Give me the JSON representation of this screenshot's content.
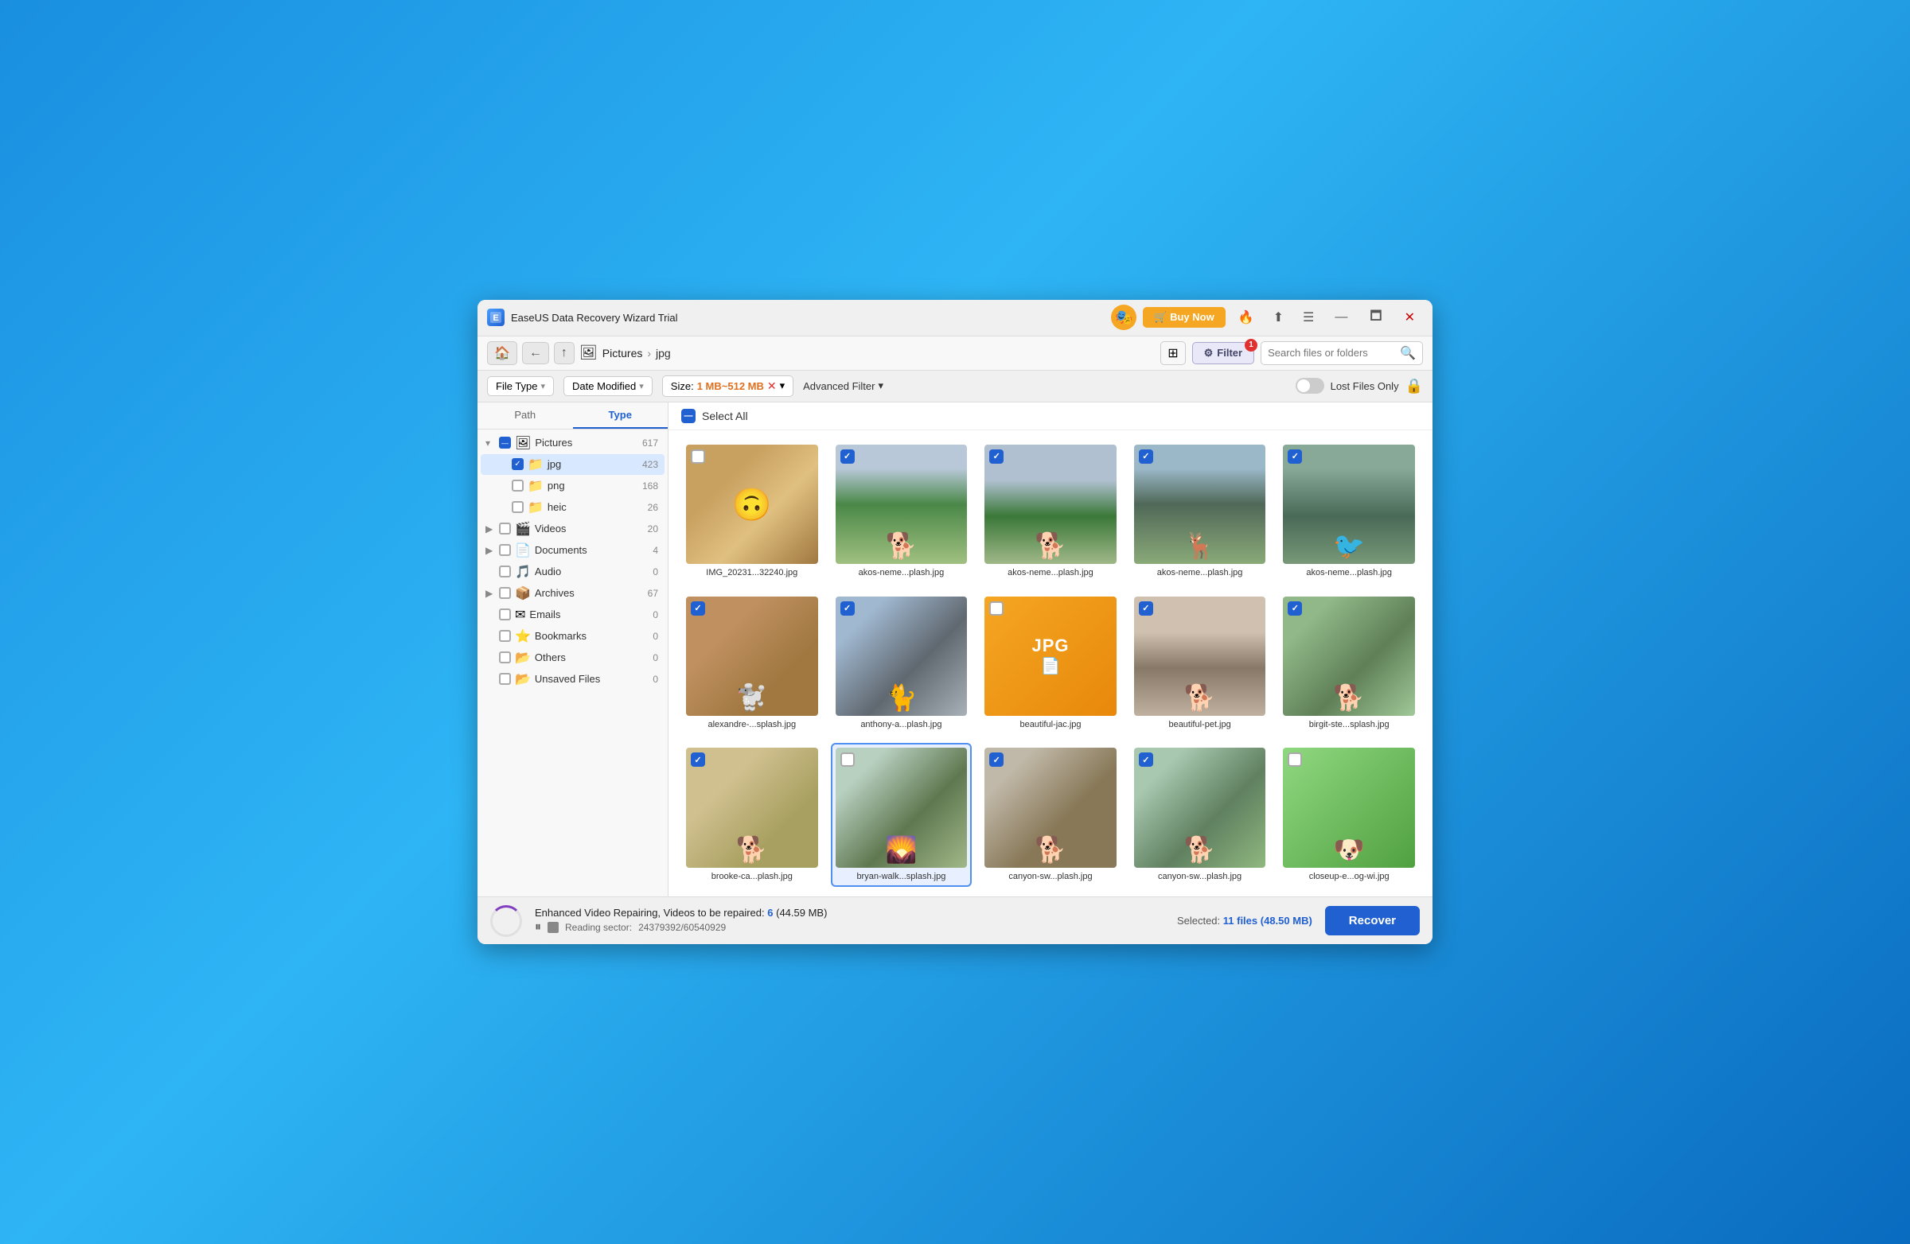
{
  "window": {
    "title": "EaseUS Data Recovery Wizard Trial",
    "logo_icon": "🔷",
    "buttons": {
      "buy_now": "🛒 Buy Now",
      "minimize": "—",
      "maximize": "🗖",
      "close": "✕"
    }
  },
  "nav": {
    "back_icon": "←",
    "up_icon": "↑",
    "home_icon": "🏠",
    "breadcrumb_icon": "🖼",
    "breadcrumb_folder": "Pictures",
    "breadcrumb_sep": "›",
    "breadcrumb_current": "jpg",
    "grid_icon": "⊞",
    "filter_label": "Filter",
    "filter_badge": "1",
    "search_placeholder": "Search files or folders"
  },
  "filters": {
    "file_type_label": "File Type",
    "date_modified_label": "Date Modified",
    "size_label": "Size:",
    "size_value": "1 MB~512 MB",
    "adv_filter_label": "Advanced Filter",
    "lost_files_label": "Lost Files Only"
  },
  "sidebar": {
    "tab_path": "Path",
    "tab_type": "Type",
    "items": [
      {
        "id": "pictures",
        "label": "Pictures",
        "count": "617",
        "level": 0,
        "checked": "partial",
        "expanded": true,
        "icon": "🖼"
      },
      {
        "id": "jpg",
        "label": "jpg",
        "count": "423",
        "level": 1,
        "checked": "checked",
        "expanded": false,
        "icon": "📁"
      },
      {
        "id": "png",
        "label": "png",
        "count": "168",
        "level": 1,
        "checked": "unchecked",
        "expanded": false,
        "icon": "📁"
      },
      {
        "id": "heic",
        "label": "heic",
        "count": "26",
        "level": 1,
        "checked": "unchecked",
        "expanded": false,
        "icon": "📁"
      },
      {
        "id": "videos",
        "label": "Videos",
        "count": "20",
        "level": 0,
        "checked": "unchecked",
        "expanded": false,
        "icon": "🎬"
      },
      {
        "id": "documents",
        "label": "Documents",
        "count": "4",
        "level": 0,
        "checked": "unchecked",
        "expanded": false,
        "icon": "📄"
      },
      {
        "id": "audio",
        "label": "Audio",
        "count": "0",
        "level": 0,
        "checked": "unchecked",
        "expanded": false,
        "icon": "🎵"
      },
      {
        "id": "archives",
        "label": "Archives",
        "count": "67",
        "level": 0,
        "checked": "unchecked",
        "expanded": false,
        "icon": "📦"
      },
      {
        "id": "emails",
        "label": "Emails",
        "count": "0",
        "level": 0,
        "checked": "unchecked",
        "expanded": false,
        "icon": "✉"
      },
      {
        "id": "bookmarks",
        "label": "Bookmarks",
        "count": "0",
        "level": 0,
        "checked": "unchecked",
        "expanded": false,
        "icon": "⭐"
      },
      {
        "id": "others",
        "label": "Others",
        "count": "0",
        "level": 0,
        "checked": "unchecked",
        "expanded": false,
        "icon": "📂"
      },
      {
        "id": "unsaved",
        "label": "Unsaved Files",
        "count": "0",
        "level": 0,
        "checked": "unchecked",
        "expanded": false,
        "icon": "📂"
      }
    ]
  },
  "file_grid": {
    "select_all_label": "Select All",
    "files": [
      {
        "name": "IMG_20231...32240.jpg",
        "checked": false,
        "photo_class": "p1"
      },
      {
        "name": "akos-neme...plash.jpg",
        "checked": true,
        "photo_class": "p2"
      },
      {
        "name": "akos-neme...plash.jpg",
        "checked": true,
        "photo_class": "p3"
      },
      {
        "name": "akos-neme...plash.jpg",
        "checked": true,
        "photo_class": "p4"
      },
      {
        "name": "akos-neme...plash.jpg",
        "checked": true,
        "photo_class": "p5"
      },
      {
        "name": "alexandre-...splash.jpg",
        "checked": true,
        "photo_class": "p6"
      },
      {
        "name": "anthony-a...plash.jpg",
        "checked": true,
        "photo_class": "p7"
      },
      {
        "name": "beautiful-jac.jpg",
        "checked": false,
        "photo_class": "jpg_icon"
      },
      {
        "name": "beautiful-pet.jpg",
        "checked": true,
        "photo_class": "p9"
      },
      {
        "name": "birgit-ste...splash.jpg",
        "checked": true,
        "photo_class": "p10"
      },
      {
        "name": "brooke-ca...plash.jpg",
        "checked": true,
        "photo_class": "p11"
      },
      {
        "name": "bryan-walk...splash.jpg",
        "checked": false,
        "photo_class": "p12",
        "selected": true
      },
      {
        "name": "canyon-sw...plash.jpg",
        "checked": true,
        "photo_class": "p13"
      },
      {
        "name": "canyon-sw...plash.jpg",
        "checked": true,
        "photo_class": "p14"
      },
      {
        "name": "closeup-e...og-wi.jpg",
        "checked": false,
        "photo_class": "p15"
      }
    ]
  },
  "status": {
    "video_repair_text": "Enhanced Video Repairing, Videos to be repaired:",
    "video_count": "6",
    "video_size": "(44.59 MB)",
    "reading_label": "Reading sector:",
    "reading_value": "24379392/60540929",
    "selected_label": "Selected:",
    "selected_count": "11 files",
    "selected_size": "(48.50 MB)",
    "recover_label": "Recover"
  }
}
